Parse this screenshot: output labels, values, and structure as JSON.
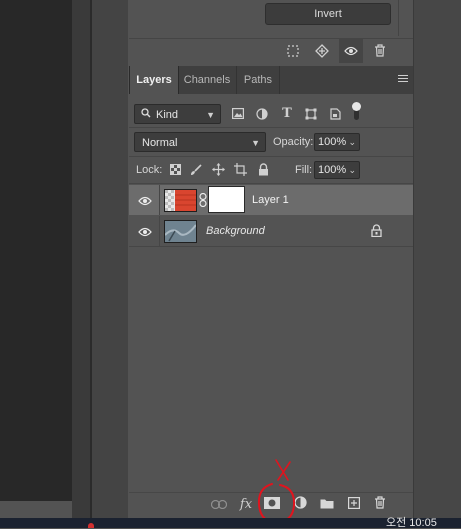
{
  "properties": {
    "invert_label": "Invert"
  },
  "layers_panel": {
    "tabs": [
      {
        "label": "Layers"
      },
      {
        "label": "Channels"
      },
      {
        "label": "Paths"
      }
    ],
    "filter": {
      "kind_label": "Kind"
    },
    "blend_mode": "Normal",
    "opacity_label": "Opacity:",
    "opacity_value": "100%",
    "lock_label": "Lock:",
    "fill_label": "Fill:",
    "fill_value": "100%",
    "layers": [
      {
        "name": "Layer 1",
        "visible": true,
        "selected": true
      },
      {
        "name": "Background",
        "visible": true,
        "locked": true
      }
    ]
  },
  "taskbar": {
    "clock_text": "오전 10:05"
  },
  "colors": {
    "panel_bg": "#535353",
    "selected_row": "#6c6c6c",
    "annotation": "#e0141e",
    "layer1_thumb": "#d9452f"
  }
}
